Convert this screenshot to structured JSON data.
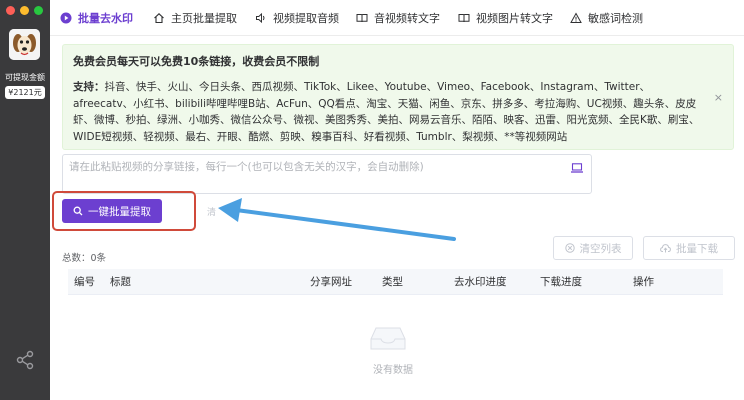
{
  "sidebar": {
    "cash_label": "可提现金额",
    "cash_amount": "¥2121元"
  },
  "tabs": [
    {
      "label": "批量去水印",
      "active": true
    },
    {
      "label": "主页批量提取",
      "active": false
    },
    {
      "label": "视频提取音频",
      "active": false
    },
    {
      "label": "音视频转文字",
      "active": false
    },
    {
      "label": "视频图片转文字",
      "active": false
    },
    {
      "label": "敏感词检测",
      "active": false
    }
  ],
  "notice": {
    "title": "免费会员每天可以免费10条链接，收费会员不限制",
    "support_label": "支持：",
    "support_text": "抖音、快手、火山、今日头条、西瓜视频、TikTok、Likee、Youtube、Vimeo、Facebook、Instagram、Twitter、afreecatv、小红书、bilibili哔哩哔哩B站、AcFun、QQ看点、淘宝、天猫、闲鱼、京东、拼多多、考拉海购、UC视频、趣头条、皮皮虾、微博、秒拍、绿洲、小咖秀、微信公众号、微视、美图秀秀、美拍、网易云音乐、陌陌、映客、迅雷、阳光宽频、全民K歌、刷宝、WIDE短视频、轻视频、最右、开眼、酷燃、剪映、糗事百科、好看视频、Tumblr、梨视频、**等视频网站",
    "close": "×"
  },
  "input": {
    "placeholder": "请在此粘贴视频的分享链接，每行一个(也可以包含无关的汉字，会自动删除)",
    "value": ""
  },
  "actions": {
    "extract": "一键批量提取",
    "clear_list": "清空列表",
    "batch_download": "批量下载"
  },
  "list": {
    "total": "总数：0条",
    "empty": "没有数据",
    "columns": [
      "编号",
      "标题",
      "分享网址",
      "类型",
      "去水印进度",
      "下载进度",
      "操作"
    ]
  },
  "colors": {
    "accent": "#6c3fd0",
    "notice_bg": "#f0f9eb",
    "sidebar_bg": "#3a3a3c",
    "annotation_red": "#d04a3a",
    "annotation_arrow": "#4a9fe0"
  }
}
